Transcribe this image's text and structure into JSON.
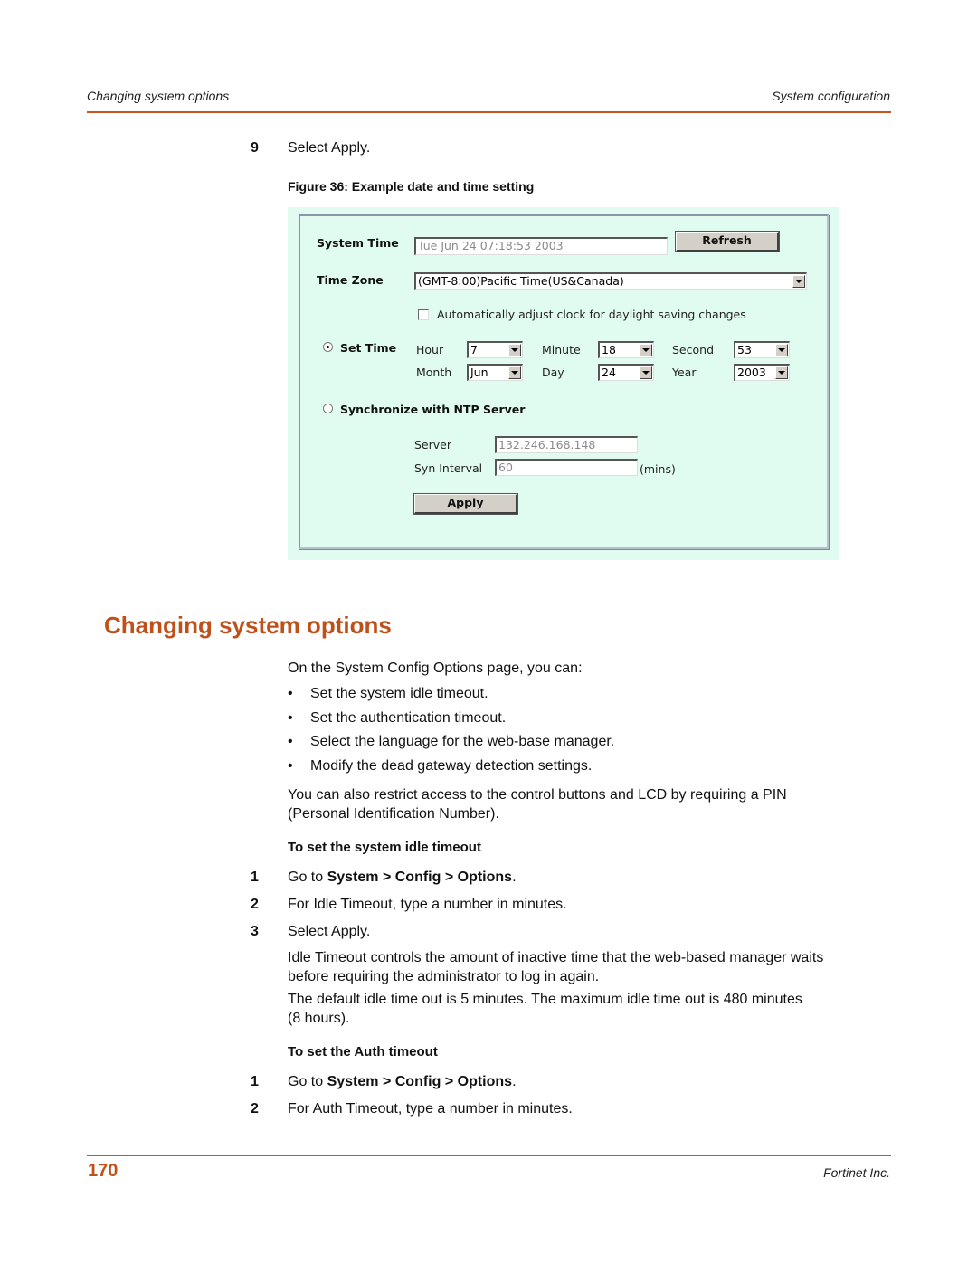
{
  "header": {
    "left": "Changing system options",
    "right": "System configuration"
  },
  "step_9": {
    "num": "9",
    "text": "Select Apply."
  },
  "figure": {
    "caption": "Figure 36: Example date and time setting",
    "screenshot": {
      "system_time_label": "System Time",
      "system_time_value": "Tue Jun 24 07:18:53 2003",
      "refresh_label": "Refresh",
      "time_zone_label": "Time Zone",
      "time_zone_value": "(GMT-8:00)Pacific Time(US&Canada)",
      "dst_checkbox_label": "Automatically adjust clock for daylight saving changes",
      "dst_checked": false,
      "set_time_label": "Set Time",
      "set_time_selected": true,
      "hour_label": "Hour",
      "hour_value": "7",
      "minute_label": "Minute",
      "minute_value": "18",
      "second_label": "Second",
      "second_value": "53",
      "month_label": "Month",
      "month_value": "Jun",
      "day_label": "Day",
      "day_value": "24",
      "year_label": "Year",
      "year_value": "2003",
      "ntp_label": "Synchronize with NTP Server",
      "ntp_selected": false,
      "server_label": "Server",
      "server_value": "132.246.168.148",
      "syn_interval_label": "Syn Interval",
      "syn_interval_value": "60",
      "mins_label": "(mins)",
      "apply_label": "Apply"
    }
  },
  "section": {
    "title": "Changing system options",
    "intro": "On the System Config Options page, you can:",
    "bullets": [
      "Set the system idle timeout.",
      "Set the authentication timeout.",
      "Select the language for the web-base manager.",
      "Modify the dead gateway detection settings."
    ],
    "pin_para_line1": "You can also restrict access to the control buttons and LCD by requiring a PIN",
    "pin_para_line2": "(Personal Identification Number).",
    "idle": {
      "heading": "To set the system idle timeout",
      "steps": [
        {
          "num": "1",
          "prefix": "Go to ",
          "bold": "System > Config > Options",
          "suffix": "."
        },
        {
          "num": "2",
          "text": "For Idle Timeout, type a number in minutes."
        },
        {
          "num": "3",
          "text": "Select Apply."
        }
      ],
      "note1_line1": "Idle Timeout controls the amount of inactive time that the web-based manager waits",
      "note1_line2": "before requiring the administrator to log in again.",
      "note2_line1": "The default idle time out is 5 minutes. The maximum idle time out is 480 minutes",
      "note2_line2": "(8 hours)."
    },
    "auth": {
      "heading": "To set the Auth timeout",
      "steps": [
        {
          "num": "1",
          "prefix": "Go to ",
          "bold": "System > Config > Options",
          "suffix": "."
        },
        {
          "num": "2",
          "text": "For Auth Timeout, type a number in minutes."
        }
      ]
    }
  },
  "footer": {
    "page_number": "170",
    "company": "Fortinet Inc."
  },
  "colors": {
    "accent": "#c0501a",
    "rule": "#c9541c",
    "panel_bg": "#e0fbf0"
  }
}
